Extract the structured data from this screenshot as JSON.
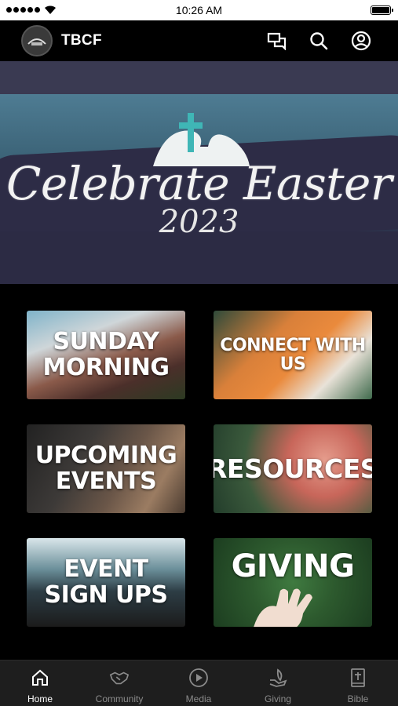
{
  "status_bar": {
    "time": "10:26 AM"
  },
  "header": {
    "title": "TBCF"
  },
  "hero": {
    "headline": "Celebrate Easter",
    "year": "2023"
  },
  "tiles": [
    {
      "label": "SUNDAY\nMORNING"
    },
    {
      "label": "CONNECT WITH US"
    },
    {
      "label": "UPCOMING\nEVENTS"
    },
    {
      "label": "RESOURCES"
    },
    {
      "label": "EVENT\nSIGN UPS"
    },
    {
      "label": "GIVING"
    }
  ],
  "tabs": [
    {
      "label": "Home",
      "icon": "home-icon",
      "active": true
    },
    {
      "label": "Community",
      "icon": "handshake-icon"
    },
    {
      "label": "Media",
      "icon": "play-icon"
    },
    {
      "label": "Giving",
      "icon": "leaf-hand-icon"
    },
    {
      "label": "Bible",
      "icon": "bible-icon"
    }
  ],
  "colors": {
    "background": "#000000",
    "subbar": "#3a3a52",
    "tabbar": "#1e1e1e",
    "tab_inactive": "#8b8b8b"
  }
}
